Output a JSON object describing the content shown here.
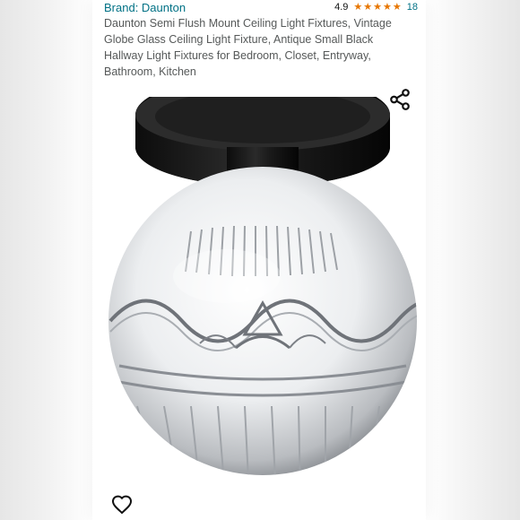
{
  "product": {
    "brand_label": "Brand: Daunton",
    "rating": "4.9",
    "review_count": "18",
    "title": "Daunton Semi Flush Mount Ceiling Light Fixtures, Vintage Globe Glass Ceiling Light Fixture, Antique Small Black Hallway Light Fixtures for Bedroom, Closet, Entryway, Bathroom, Kitchen",
    "stars": 5
  },
  "icons": {
    "share": "share-icon",
    "favorite": "heart-icon",
    "star": "star-icon"
  },
  "colors": {
    "link": "#007185",
    "star": "#e77600",
    "title_text": "#565959"
  }
}
